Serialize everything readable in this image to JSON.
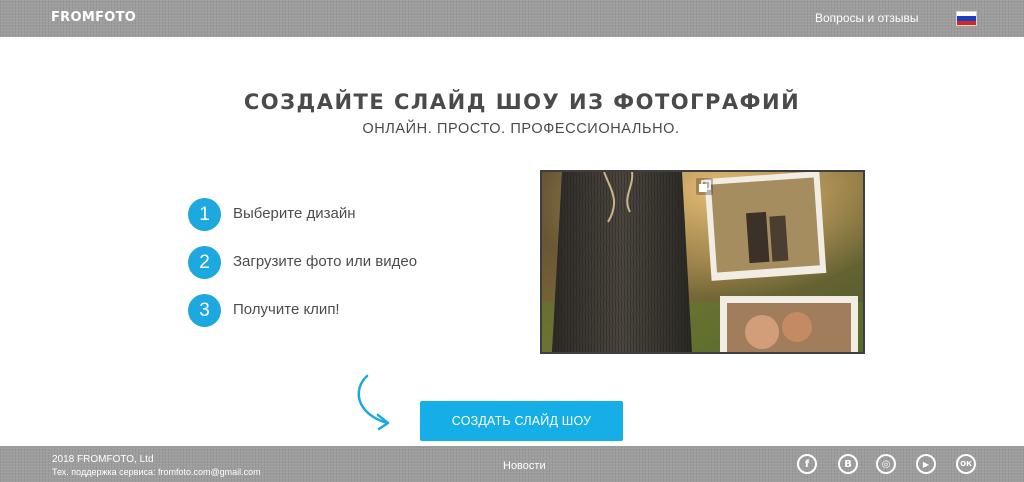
{
  "header": {
    "logo": "FROMFOTO",
    "faq_link": "Вопросы и отзывы",
    "language_flag": "flag-ru-icon",
    "flag_colors": [
      "#ffffff",
      "#1c3fbf",
      "#d62718"
    ]
  },
  "hero": {
    "title": "СОЗДАЙТЕ СЛАЙД ШОУ ИЗ ФОТОГРАФИЙ",
    "subtitle": "ОНЛАЙН. ПРОСТО. ПРОФЕССИОНАЛЬНО."
  },
  "steps": [
    {
      "number": "1",
      "text": "Выберите дизайн"
    },
    {
      "number": "2",
      "text": "Загрузите фото или видео"
    },
    {
      "number": "3",
      "text": "Получите клип!"
    }
  ],
  "preview": {
    "expand_icon": "expand-icon"
  },
  "cta": {
    "label": "СОЗДАТЬ СЛАЙД ШОУ"
  },
  "footer": {
    "copyright": "2018 FROMFOTO, Ltd",
    "support": "Тех. поддержка сервиса: fromfoto.com@gmail.com",
    "news": "Новости",
    "social": [
      {
        "icon": "facebook-icon",
        "glyph": "f"
      },
      {
        "icon": "vk-icon",
        "glyph": "B"
      },
      {
        "icon": "instagram-icon",
        "glyph": "◎"
      },
      {
        "icon": "youtube-icon",
        "glyph": "▶"
      },
      {
        "icon": "odnoklassniki-icon",
        "glyph": "ОК"
      }
    ]
  },
  "colors": {
    "accent": "#15aee6",
    "bar_gray": "#9d9d9d",
    "text_dark": "#4a4a4a"
  }
}
